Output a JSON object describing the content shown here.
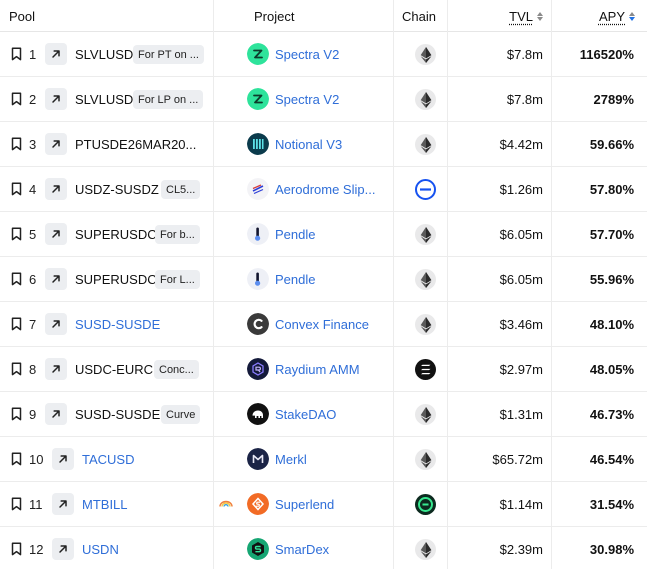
{
  "header": {
    "pool": "Pool",
    "project": "Project",
    "chain": "Chain",
    "tvl": "TVL",
    "apy": "APY"
  },
  "colors": {
    "link": "#2f6ed8",
    "sort_active": "#2172e5",
    "tag_bg": "#eceef1"
  },
  "rows": [
    {
      "rank": "1",
      "pool": "SLVLUSD",
      "pool_is_link": false,
      "tag": "For PT on ...",
      "project": "Spectra V2",
      "project_icon": "spectra-logo-icon",
      "chain_icon": "ethereum-chain-icon",
      "tvl": "$7.8m",
      "apy": "116520%"
    },
    {
      "rank": "2",
      "pool": "SLVLUSD",
      "pool_is_link": false,
      "tag": "For LP on ...",
      "project": "Spectra V2",
      "project_icon": "spectra-logo-icon",
      "chain_icon": "ethereum-chain-icon",
      "tvl": "$7.8m",
      "apy": "2789%"
    },
    {
      "rank": "3",
      "pool": "PTUSDE26MAR20...",
      "pool_is_link": false,
      "tag": "",
      "project": "Notional V3",
      "project_icon": "notional-logo-icon",
      "chain_icon": "ethereum-chain-icon",
      "tvl": "$4.42m",
      "apy": "59.66%"
    },
    {
      "rank": "4",
      "pool": "USDZ-SUSDZ",
      "pool_is_link": false,
      "tag": "CL5...",
      "project": "Aerodrome Slip...",
      "project_icon": "aerodrome-logo-icon",
      "chain_icon": "base-chain-icon",
      "tvl": "$1.26m",
      "apy": "57.80%"
    },
    {
      "rank": "5",
      "pool": "SUPERUSDC",
      "pool_is_link": false,
      "tag": "For b...",
      "project": "Pendle",
      "project_icon": "pendle-logo-icon",
      "chain_icon": "ethereum-chain-icon",
      "tvl": "$6.05m",
      "apy": "57.70%"
    },
    {
      "rank": "6",
      "pool": "SUPERUSDC",
      "pool_is_link": false,
      "tag": "For L...",
      "project": "Pendle",
      "project_icon": "pendle-logo-icon",
      "chain_icon": "ethereum-chain-icon",
      "tvl": "$6.05m",
      "apy": "55.96%"
    },
    {
      "rank": "7",
      "pool": "SUSD-SUSDE",
      "pool_is_link": true,
      "tag": "",
      "project": "Convex Finance",
      "project_icon": "convex-logo-icon",
      "chain_icon": "ethereum-chain-icon",
      "tvl": "$3.46m",
      "apy": "48.10%"
    },
    {
      "rank": "8",
      "pool": "USDC-EURC",
      "pool_is_link": false,
      "tag": "Conc...",
      "project": "Raydium AMM",
      "project_icon": "raydium-logo-icon",
      "chain_icon": "solana-chain-icon",
      "tvl": "$2.97m",
      "apy": "48.05%"
    },
    {
      "rank": "9",
      "pool": "SUSD-SUSDE",
      "pool_is_link": false,
      "tag": "Curve",
      "project": "StakeDAO",
      "project_icon": "stakedao-logo-icon",
      "chain_icon": "ethereum-chain-icon",
      "tvl": "$1.31m",
      "apy": "46.73%"
    },
    {
      "rank": "10",
      "pool": "TACUSD",
      "pool_is_link": true,
      "tag": "",
      "project": "Merkl",
      "project_icon": "merkl-logo-icon",
      "chain_icon": "ethereum-chain-icon",
      "tvl": "$65.72m",
      "apy": "46.54%"
    },
    {
      "rank": "11",
      "pool": "MTBILL",
      "pool_is_link": true,
      "tag": "",
      "extra_icon": "rainbow-reward-icon",
      "project": "Superlend",
      "project_icon": "superlend-logo-icon",
      "chain_icon": "etherlink-chain-icon",
      "tvl": "$1.14m",
      "apy": "31.54%"
    },
    {
      "rank": "12",
      "pool": "USDN",
      "pool_is_link": true,
      "tag": "",
      "project": "SmarDex",
      "project_icon": "smardex-logo-icon",
      "chain_icon": "ethereum-chain-icon",
      "tvl": "$2.39m",
      "apy": "30.98%"
    }
  ]
}
